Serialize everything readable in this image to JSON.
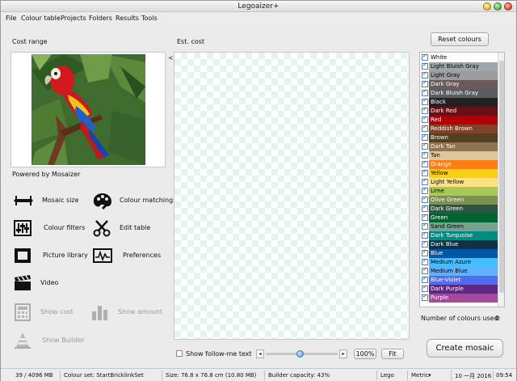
{
  "window": {
    "title": "Legoaizer+",
    "controls": [
      {
        "name": "minimize",
        "color": "#f2c23a"
      },
      {
        "name": "maximize",
        "color": "#5cc24c"
      },
      {
        "name": "close",
        "color": "#e5533d"
      }
    ]
  },
  "menu": [
    "File",
    "Colour table",
    "Projects",
    "Folders",
    "Results",
    "Tools"
  ],
  "left": {
    "cost_range_label": "Cost range",
    "powered_by": "Powered by Mosaizer",
    "collapse_arrow": "<"
  },
  "center": {
    "est_cost_label": "Est. cost"
  },
  "tools": [
    {
      "label": "Mosaic size",
      "icon": "mosaic-size-icon",
      "enabled": true
    },
    {
      "label": "Colour matching",
      "icon": "palette-icon",
      "enabled": true
    },
    {
      "label": "Colour filters",
      "icon": "sliders-icon",
      "enabled": true
    },
    {
      "label": "Edit table",
      "icon": "scissors-icon",
      "enabled": true
    },
    {
      "label": "Picture library",
      "icon": "picture-frame-icon",
      "enabled": true
    },
    {
      "label": "Preferences",
      "icon": "preferences-icon",
      "enabled": true
    },
    {
      "label": "Video",
      "icon": "clapperboard-icon",
      "enabled": true
    },
    {
      "label": "Show cost",
      "icon": "calculator-icon",
      "enabled": false
    },
    {
      "label": "Show amount",
      "icon": "bar-chart-icon",
      "enabled": false
    },
    {
      "label": "Show Builder",
      "icon": "cone-icon",
      "enabled": false
    }
  ],
  "right": {
    "reset_label": "Reset colours",
    "colours_used_label": "Number of colours used:",
    "colours_used_value": "0",
    "create_label": "Create mosaic",
    "colours": [
      {
        "name": "White",
        "hex": "#ffffff",
        "text": "#000000"
      },
      {
        "name": "Light Bluish Gray",
        "hex": "#a0a5a9",
        "text": "#000000"
      },
      {
        "name": "Light Gray",
        "hex": "#9c9c9c",
        "text": "#000000"
      },
      {
        "name": "Dark Gray",
        "hex": "#6b5a5a",
        "text": "#ffffff"
      },
      {
        "name": "Dark Bluish Gray",
        "hex": "#595d60",
        "text": "#ffffff"
      },
      {
        "name": "Black",
        "hex": "#212121",
        "text": "#ffffff"
      },
      {
        "name": "Dark Red",
        "hex": "#6a0e15",
        "text": "#ffffff"
      },
      {
        "name": "Red",
        "hex": "#b30006",
        "text": "#ffffff"
      },
      {
        "name": "Reddish Brown",
        "hex": "#82422a",
        "text": "#ffffff"
      },
      {
        "name": "Brown",
        "hex": "#533f21",
        "text": "#ffffff"
      },
      {
        "name": "Dark Tan",
        "hex": "#907450",
        "text": "#ffffff"
      },
      {
        "name": "Tan",
        "hex": "#dec69c",
        "text": "#000000"
      },
      {
        "name": "Orange",
        "hex": "#ff7e14",
        "text": "#ffffff"
      },
      {
        "name": "Yellow",
        "hex": "#f7d117",
        "text": "#000000"
      },
      {
        "name": "Light Yellow",
        "hex": "#ffe383",
        "text": "#000000"
      },
      {
        "name": "Lime",
        "hex": "#a6ca55",
        "text": "#000000"
      },
      {
        "name": "Olive Green",
        "hex": "#7c9051",
        "text": "#ffffff"
      },
      {
        "name": "Dark Green",
        "hex": "#2e5543",
        "text": "#ffffff"
      },
      {
        "name": "Green",
        "hex": "#00642e",
        "text": "#ffffff"
      },
      {
        "name": "Sand Green",
        "hex": "#76a290",
        "text": "#000000"
      },
      {
        "name": "Dark Turquoise",
        "hex": "#008a80",
        "text": "#ffffff"
      },
      {
        "name": "Dark Blue",
        "hex": "#143044",
        "text": "#ffffff"
      },
      {
        "name": "Blue",
        "hex": "#0057a6",
        "text": "#ffffff"
      },
      {
        "name": "Medium Azure",
        "hex": "#42c0fb",
        "text": "#000000"
      },
      {
        "name": "Medium Blue",
        "hex": "#61afff",
        "text": "#000000"
      },
      {
        "name": "Blue-Violet",
        "hex": "#506cef",
        "text": "#ffffff"
      },
      {
        "name": "Dark Purple",
        "hex": "#5f2683",
        "text": "#ffffff"
      },
      {
        "name": "Purple",
        "hex": "#a5499c",
        "text": "#ffffff"
      }
    ]
  },
  "bottom": {
    "show_follow_label": "Show follow-me text",
    "zoom_value": "100%",
    "fit_label": "Fit"
  },
  "status": {
    "memory": "39 / 4096 MB",
    "colour_set": "Colour set: StartBricklinkSet",
    "size": "Size: 76.8 x 76.8 cm (10.80 MB)",
    "capacity": "Builder capacity: 43%",
    "brand": "Lego",
    "units": "Metric",
    "date": "10 一月 2016",
    "time": "09:54"
  }
}
